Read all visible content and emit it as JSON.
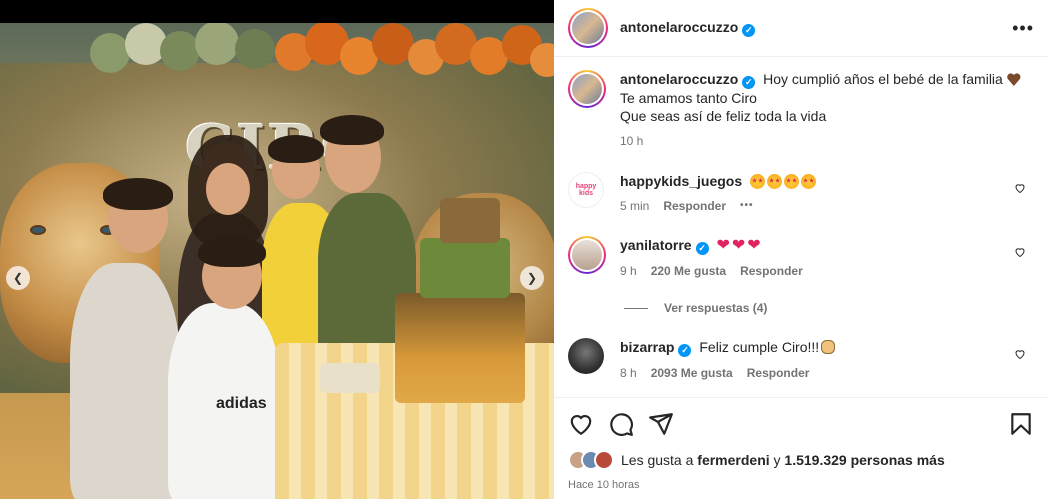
{
  "post": {
    "username": "antonelaroccuzzo",
    "caption_lines": [
      "Hoy cumplió años el bebé de la familia",
      "Te amamos tanto Ciro",
      "Que seas así de feliz toda la vida"
    ],
    "caption_time": "10 h",
    "photo_banner_text": "CIRO",
    "shirt_text": "adidas"
  },
  "comments": [
    {
      "user": "happykids_juegos",
      "verified": false,
      "text": "",
      "emoji": "star-struck-x4",
      "time": "5 min",
      "likes": "",
      "reply": "Responder",
      "more": "•••",
      "avatar_label": "happy kids"
    },
    {
      "user": "yanilatorre",
      "verified": true,
      "text": "",
      "emoji": "red-heart-x3",
      "time": "9 h",
      "likes": "220 Me gusta",
      "reply": "Responder"
    },
    {
      "user": "bizarrap",
      "verified": true,
      "text": "Feliz cumple Ciro!!!",
      "emoji": "clapping-hands",
      "time": "8 h",
      "likes": "2093 Me gusta",
      "reply": "Responder"
    }
  ],
  "view_replies": "Ver respuestas (4)",
  "likes": {
    "prefix": "Les gusta a",
    "user": "fermerdeni",
    "conj": "y",
    "count": "1.519.329 personas más"
  },
  "posted_ago": "Hace 10 horas",
  "colors": {
    "verified": "#0095f6",
    "muted": "#737373",
    "heart": "#e0245e"
  },
  "icons": [
    "more-options-icon",
    "like-icon",
    "comment-icon",
    "share-icon",
    "save-icon",
    "verified-badge-icon",
    "small-heart-icon",
    "prev-arrow-icon",
    "next-arrow-icon"
  ]
}
